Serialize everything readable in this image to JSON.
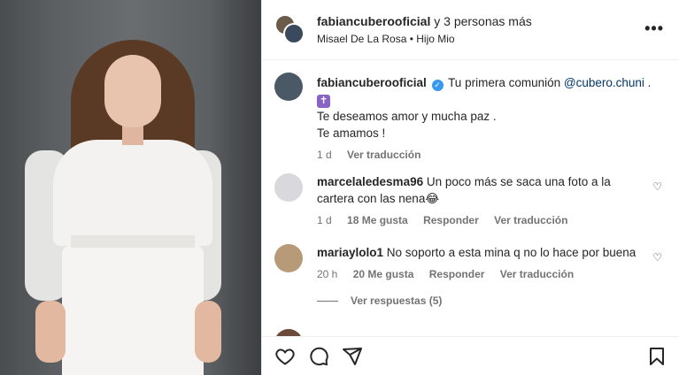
{
  "header": {
    "username": "fabiancuberooficial",
    "others": " y 3 personas más",
    "subtitle": "Misael De La Rosa • Hijo Mio",
    "more_icon": "more-horizontal-icon"
  },
  "caption": {
    "username": "fabiancuberooficial",
    "text_before": " Tu primera comunión ",
    "mention": "@cubero.chuni",
    "text_after": " .",
    "emoji": "✝",
    "line2": "Te deseamos amor y mucha paz .",
    "line3": "Te amamos !",
    "time": "1 d",
    "translate": "Ver traducción"
  },
  "comments": [
    {
      "username": "marcelaledesma96",
      "text": " Un poco más se saca una foto a la cartera con las nena😂",
      "time": "1 d",
      "likes": "18 Me gusta",
      "reply": "Responder",
      "translate": "Ver traducción",
      "avatar_color": "#d9d9dd"
    },
    {
      "username": "mariaylolo1",
      "text": " No soporto a esta mina q no lo hace por buena",
      "time": "20 h",
      "likes": "20 Me gusta",
      "reply": "Responder",
      "translate": "Ver traducción",
      "avatar_color": "#b79a78"
    }
  ],
  "replies": {
    "label": "Ver respuestas (5)"
  },
  "actions": {
    "like_icon": "heart-icon",
    "comment_icon": "comment-icon",
    "share_icon": "send-icon",
    "save_icon": "bookmark-icon"
  }
}
